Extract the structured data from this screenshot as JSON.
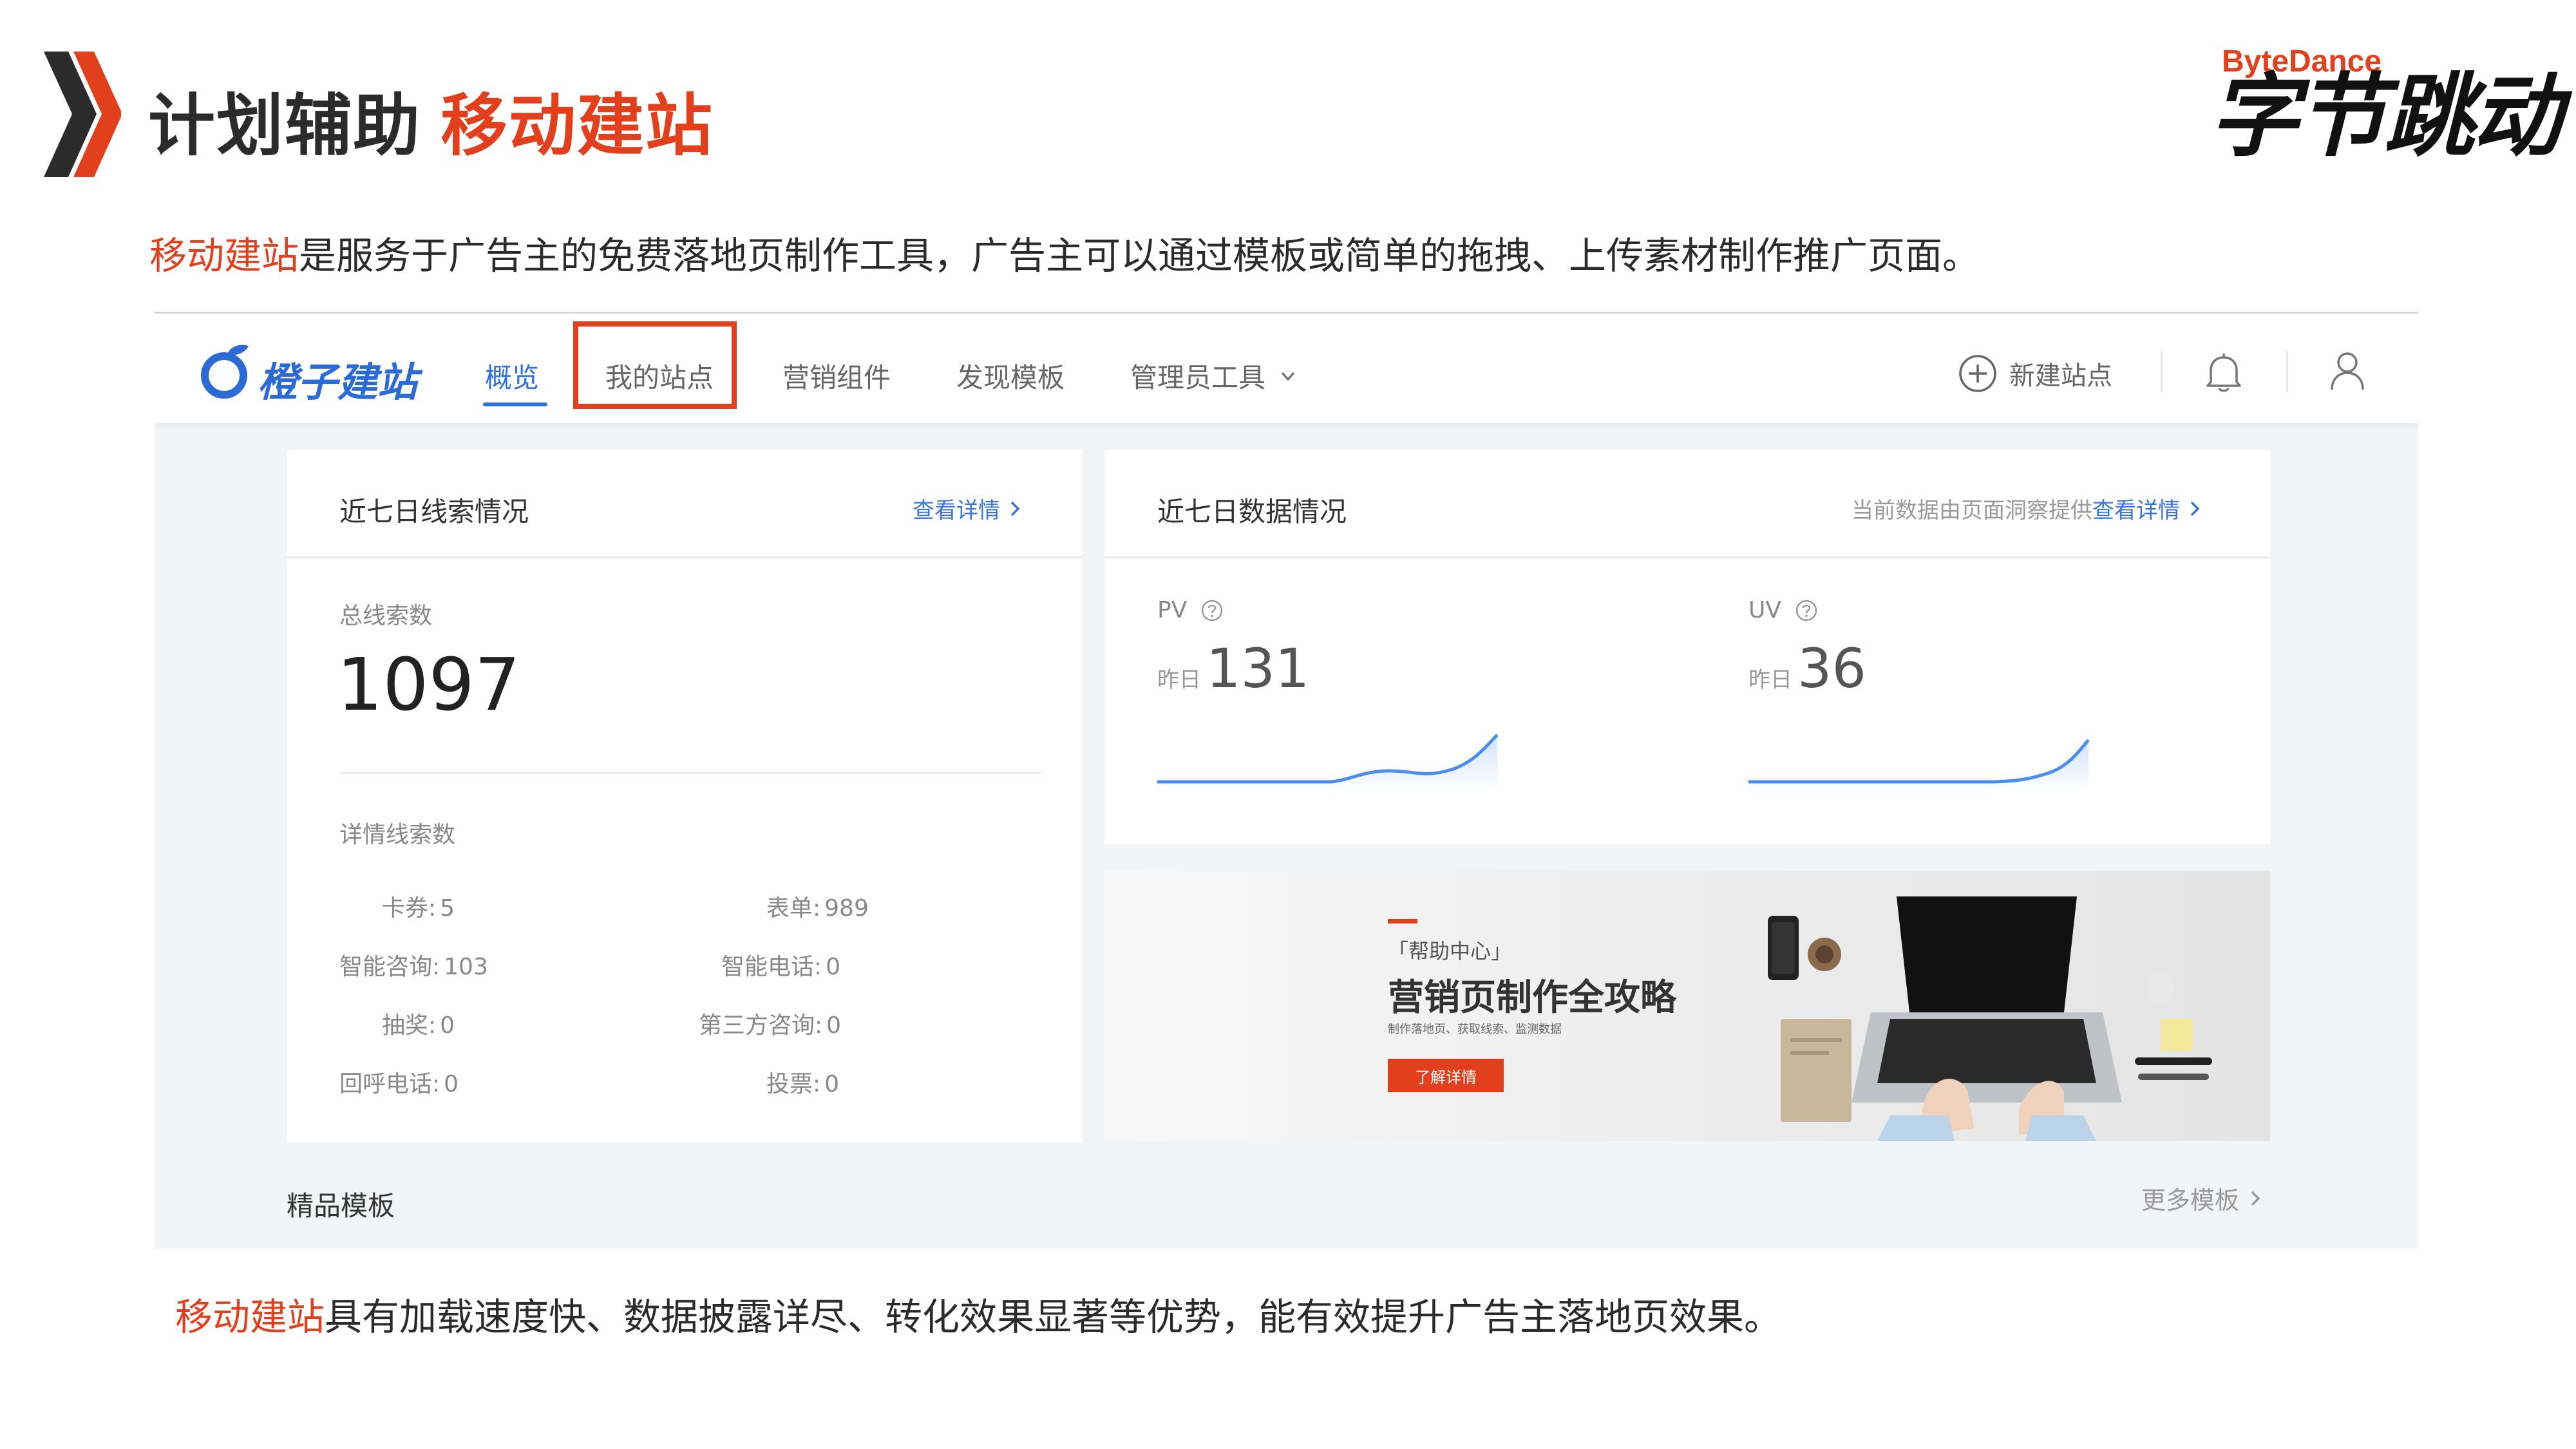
{
  "slide": {
    "title_main": "计划辅助",
    "title_accent": "移动建站",
    "brand_en": "ByteDance",
    "brand_cn": "字节跳动",
    "intro_highlight": "移动建站",
    "intro_rest": "是服务于广告主的免费落地页制作工具，广告主可以通过模板或简单的拖拽、上传素材制作推广页面。",
    "outro_highlight": "移动建站",
    "outro_rest": "具有加载速度快、数据披露详尽、转化效果显著等优势，能有效提升广告主落地页效果。"
  },
  "app": {
    "logo_text": "橙子建站",
    "nav": [
      {
        "label": "概览"
      },
      {
        "label": "我的站点"
      },
      {
        "label": "营销组件"
      },
      {
        "label": "发现模板"
      },
      {
        "label": "管理员工具"
      }
    ],
    "new_site_label": "新建站点"
  },
  "leads": {
    "title": "近七日线索情况",
    "detail_link": "查看详情",
    "total_label": "总线索数",
    "total_value": "1097",
    "detail_label": "详情线索数",
    "items": [
      {
        "label": "卡券:",
        "value": "5"
      },
      {
        "label": "表单:",
        "value": "989"
      },
      {
        "label": "智能咨询:",
        "value": "103"
      },
      {
        "label": "智能电话:",
        "value": "0"
      },
      {
        "label": "抽奖:",
        "value": "0"
      },
      {
        "label": "第三方咨询:",
        "value": "0"
      },
      {
        "label": "回呼电话:",
        "value": "0"
      },
      {
        "label": "投票:",
        "value": "0"
      }
    ]
  },
  "data_overview": {
    "title": "近七日数据情况",
    "source_note": "当前数据由页面洞察提供",
    "detail_link": "查看详情",
    "pv": {
      "label": "PV",
      "prefix": "昨日",
      "value": "131"
    },
    "uv": {
      "label": "UV",
      "prefix": "昨日",
      "value": "36"
    }
  },
  "banner": {
    "help_tag": "「帮助中心」",
    "title": "营销页制作全攻略",
    "subtitle": "制作落地页、获取线索、监测数据",
    "button": "了解详情"
  },
  "templates": {
    "section_title": "精品模板",
    "more_link": "更多模板"
  },
  "colors": {
    "accent": "#e2401c",
    "link_blue": "#3a74d8",
    "chart_line": "#4a8ef0"
  }
}
